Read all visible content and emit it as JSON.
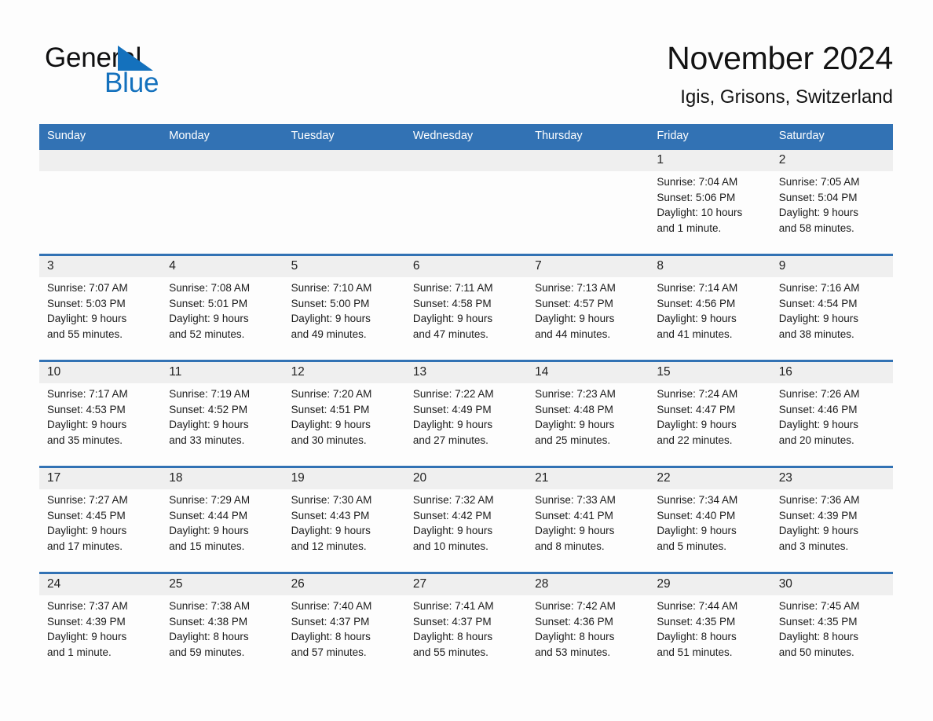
{
  "brand": {
    "name_part1": "General",
    "name_part2": "Blue",
    "accent_color": "#1471bd"
  },
  "header": {
    "title": "November 2024",
    "location": "Igis, Grisons, Switzerland"
  },
  "theme": {
    "header_bg": "#3272b4",
    "daynum_band_bg": "#efefef",
    "page_bg": "#fdfdfd",
    "text_color": "#1b1b1b"
  },
  "weekdays": [
    "Sunday",
    "Monday",
    "Tuesday",
    "Wednesday",
    "Thursday",
    "Friday",
    "Saturday"
  ],
  "weeks": [
    [
      {
        "day": "",
        "detail": ""
      },
      {
        "day": "",
        "detail": ""
      },
      {
        "day": "",
        "detail": ""
      },
      {
        "day": "",
        "detail": ""
      },
      {
        "day": "",
        "detail": ""
      },
      {
        "day": "1",
        "detail": "Sunrise: 7:04 AM\nSunset: 5:06 PM\nDaylight: 10 hours\nand 1 minute."
      },
      {
        "day": "2",
        "detail": "Sunrise: 7:05 AM\nSunset: 5:04 PM\nDaylight: 9 hours\nand 58 minutes."
      }
    ],
    [
      {
        "day": "3",
        "detail": "Sunrise: 7:07 AM\nSunset: 5:03 PM\nDaylight: 9 hours\nand 55 minutes."
      },
      {
        "day": "4",
        "detail": "Sunrise: 7:08 AM\nSunset: 5:01 PM\nDaylight: 9 hours\nand 52 minutes."
      },
      {
        "day": "5",
        "detail": "Sunrise: 7:10 AM\nSunset: 5:00 PM\nDaylight: 9 hours\nand 49 minutes."
      },
      {
        "day": "6",
        "detail": "Sunrise: 7:11 AM\nSunset: 4:58 PM\nDaylight: 9 hours\nand 47 minutes."
      },
      {
        "day": "7",
        "detail": "Sunrise: 7:13 AM\nSunset: 4:57 PM\nDaylight: 9 hours\nand 44 minutes."
      },
      {
        "day": "8",
        "detail": "Sunrise: 7:14 AM\nSunset: 4:56 PM\nDaylight: 9 hours\nand 41 minutes."
      },
      {
        "day": "9",
        "detail": "Sunrise: 7:16 AM\nSunset: 4:54 PM\nDaylight: 9 hours\nand 38 minutes."
      }
    ],
    [
      {
        "day": "10",
        "detail": "Sunrise: 7:17 AM\nSunset: 4:53 PM\nDaylight: 9 hours\nand 35 minutes."
      },
      {
        "day": "11",
        "detail": "Sunrise: 7:19 AM\nSunset: 4:52 PM\nDaylight: 9 hours\nand 33 minutes."
      },
      {
        "day": "12",
        "detail": "Sunrise: 7:20 AM\nSunset: 4:51 PM\nDaylight: 9 hours\nand 30 minutes."
      },
      {
        "day": "13",
        "detail": "Sunrise: 7:22 AM\nSunset: 4:49 PM\nDaylight: 9 hours\nand 27 minutes."
      },
      {
        "day": "14",
        "detail": "Sunrise: 7:23 AM\nSunset: 4:48 PM\nDaylight: 9 hours\nand 25 minutes."
      },
      {
        "day": "15",
        "detail": "Sunrise: 7:24 AM\nSunset: 4:47 PM\nDaylight: 9 hours\nand 22 minutes."
      },
      {
        "day": "16",
        "detail": "Sunrise: 7:26 AM\nSunset: 4:46 PM\nDaylight: 9 hours\nand 20 minutes."
      }
    ],
    [
      {
        "day": "17",
        "detail": "Sunrise: 7:27 AM\nSunset: 4:45 PM\nDaylight: 9 hours\nand 17 minutes."
      },
      {
        "day": "18",
        "detail": "Sunrise: 7:29 AM\nSunset: 4:44 PM\nDaylight: 9 hours\nand 15 minutes."
      },
      {
        "day": "19",
        "detail": "Sunrise: 7:30 AM\nSunset: 4:43 PM\nDaylight: 9 hours\nand 12 minutes."
      },
      {
        "day": "20",
        "detail": "Sunrise: 7:32 AM\nSunset: 4:42 PM\nDaylight: 9 hours\nand 10 minutes."
      },
      {
        "day": "21",
        "detail": "Sunrise: 7:33 AM\nSunset: 4:41 PM\nDaylight: 9 hours\nand 8 minutes."
      },
      {
        "day": "22",
        "detail": "Sunrise: 7:34 AM\nSunset: 4:40 PM\nDaylight: 9 hours\nand 5 minutes."
      },
      {
        "day": "23",
        "detail": "Sunrise: 7:36 AM\nSunset: 4:39 PM\nDaylight: 9 hours\nand 3 minutes."
      }
    ],
    [
      {
        "day": "24",
        "detail": "Sunrise: 7:37 AM\nSunset: 4:39 PM\nDaylight: 9 hours\nand 1 minute."
      },
      {
        "day": "25",
        "detail": "Sunrise: 7:38 AM\nSunset: 4:38 PM\nDaylight: 8 hours\nand 59 minutes."
      },
      {
        "day": "26",
        "detail": "Sunrise: 7:40 AM\nSunset: 4:37 PM\nDaylight: 8 hours\nand 57 minutes."
      },
      {
        "day": "27",
        "detail": "Sunrise: 7:41 AM\nSunset: 4:37 PM\nDaylight: 8 hours\nand 55 minutes."
      },
      {
        "day": "28",
        "detail": "Sunrise: 7:42 AM\nSunset: 4:36 PM\nDaylight: 8 hours\nand 53 minutes."
      },
      {
        "day": "29",
        "detail": "Sunrise: 7:44 AM\nSunset: 4:35 PM\nDaylight: 8 hours\nand 51 minutes."
      },
      {
        "day": "30",
        "detail": "Sunrise: 7:45 AM\nSunset: 4:35 PM\nDaylight: 8 hours\nand 50 minutes."
      }
    ]
  ]
}
